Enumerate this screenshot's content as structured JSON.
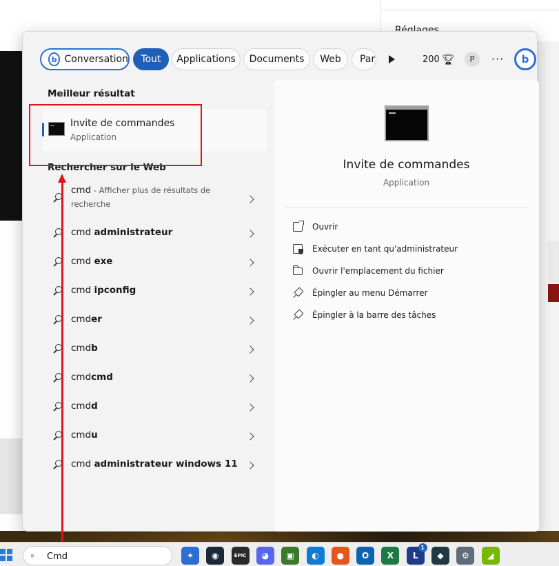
{
  "background": {
    "settings_label": "Réglages"
  },
  "tabs": {
    "conversation": "Conversation",
    "all": "Tout",
    "applications": "Applications",
    "documents": "Documents",
    "web": "Web",
    "para": "Para"
  },
  "header": {
    "points": "200",
    "avatar_letter": "P",
    "more_label": "···",
    "bing_letter": "b"
  },
  "best_result": {
    "section_title": "Meilleur résultat",
    "name": "Invite de commandes",
    "type": "Application"
  },
  "web_search": {
    "section_title": "Rechercher sur le Web",
    "first": {
      "prefix": "cmd",
      "hint": " - Afficher plus de résultats de recherche"
    },
    "items": [
      {
        "prefix": "cmd ",
        "bold": "administrateur"
      },
      {
        "prefix": "cmd ",
        "bold": "exe"
      },
      {
        "prefix": "cmd ",
        "bold": "ipconfig"
      },
      {
        "prefix": "cmd",
        "bold": "er"
      },
      {
        "prefix": "cmd",
        "bold": "b"
      },
      {
        "prefix": "cmd",
        "bold": "cmd"
      },
      {
        "prefix": "cmd",
        "bold": "d"
      },
      {
        "prefix": "cmd",
        "bold": "u"
      },
      {
        "prefix": "cmd ",
        "bold": "administrateur windows 11"
      }
    ]
  },
  "preview": {
    "title": "Invite de commandes",
    "subtitle": "Application",
    "actions": [
      "Ouvrir",
      "Exécuter en tant qu'administrateur",
      "Ouvrir l'emplacement du fichier",
      "Épingler au menu Démarrer",
      "Épingler à la barre des tâches"
    ]
  },
  "taskbar": {
    "search_value": "Cmd",
    "apps": [
      {
        "name": "copilot-app-icon",
        "glyph": "✦",
        "color": "#2c6fd1"
      },
      {
        "name": "steam-app-icon",
        "glyph": "◉",
        "color": "#1b2838"
      },
      {
        "name": "epic-games-app-icon",
        "glyph": "EPIC",
        "color": "#2a2a2a"
      },
      {
        "name": "discord-app-icon",
        "glyph": "◕",
        "color": "#5865f2"
      },
      {
        "name": "game-app-icon",
        "glyph": "▣",
        "color": "#3c7a2a"
      },
      {
        "name": "edge-app-icon",
        "glyph": "◐",
        "color": "#0f7bd3"
      },
      {
        "name": "firefox-app-icon",
        "glyph": "●",
        "color": "#e8541d"
      },
      {
        "name": "outlook-app-icon",
        "glyph": "O",
        "color": "#0a64b0"
      },
      {
        "name": "excel-app-icon",
        "glyph": "X",
        "color": "#1d7a44"
      },
      {
        "name": "l-app-icon",
        "glyph": "L",
        "color": "#1f3c8a",
        "badge": "1"
      },
      {
        "name": "dark-app-icon",
        "glyph": "◆",
        "color": "#1f3a40"
      },
      {
        "name": "settings-app-icon",
        "glyph": "⚙",
        "color": "#5f6d7a"
      },
      {
        "name": "nvidia-app-icon",
        "glyph": "◢",
        "color": "#76b900"
      }
    ]
  },
  "colors": {
    "accent": "#1f5fb8",
    "annotation": "#e0141e"
  }
}
